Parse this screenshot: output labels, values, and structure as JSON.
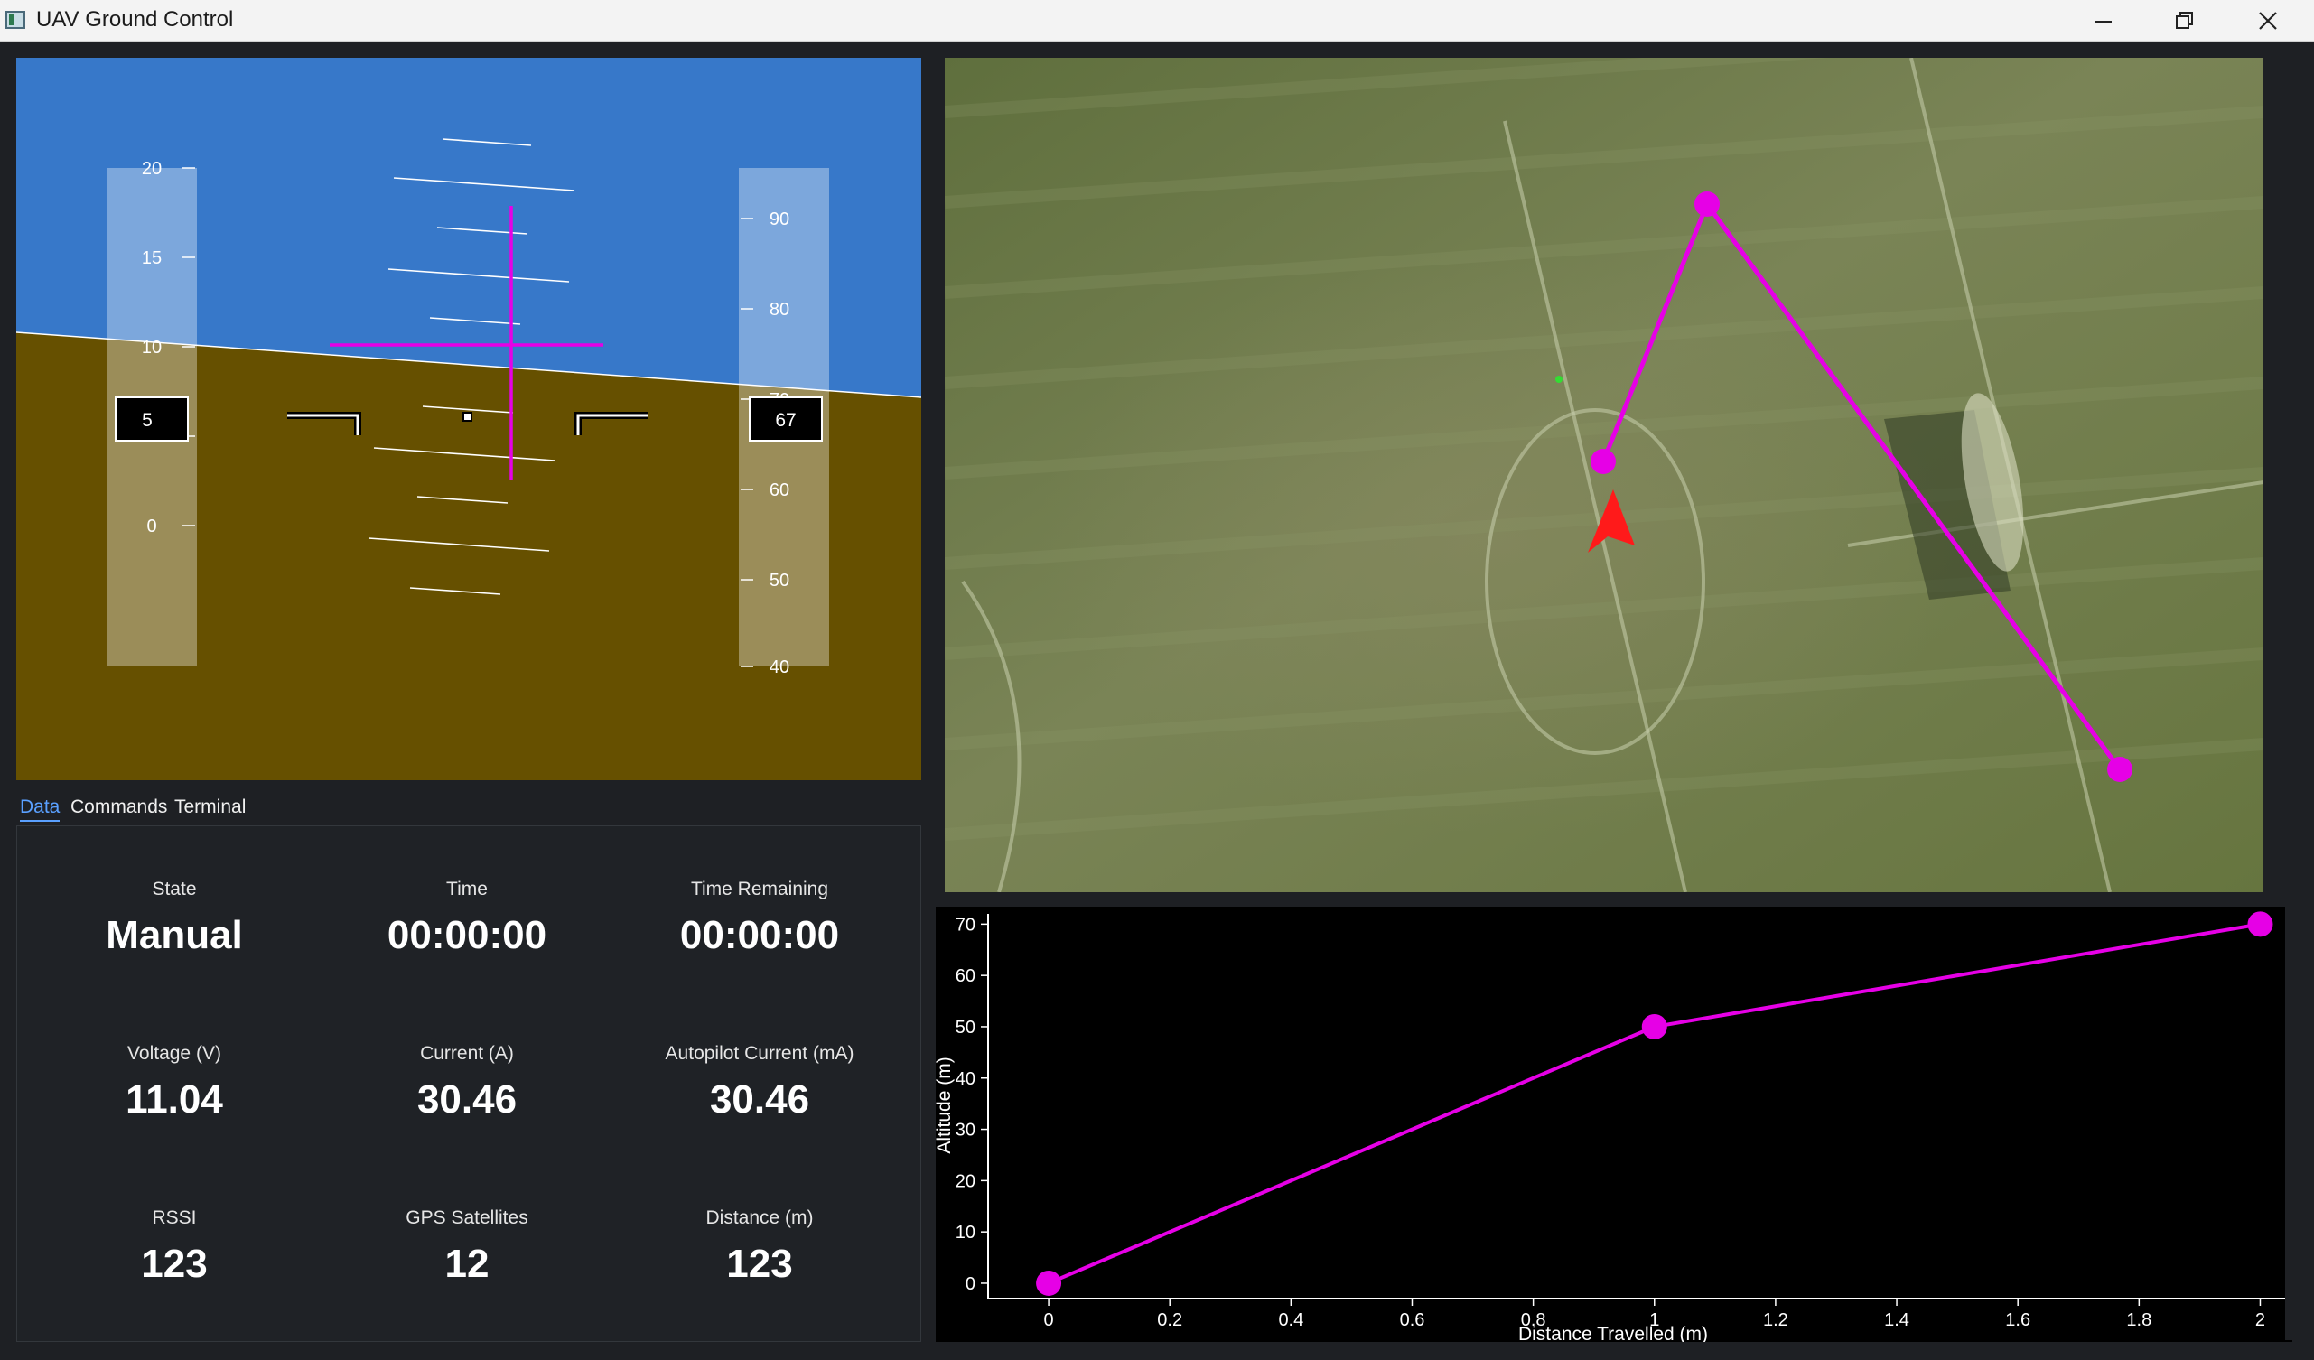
{
  "window": {
    "title": "UAV Ground Control",
    "minimize_icon": "minimize-icon",
    "maximize_icon": "restore-icon",
    "close_icon": "close-icon"
  },
  "attitude": {
    "sky_color": "#3778c9",
    "ground_color": "#665000",
    "accent_color": "#e600e6",
    "speed_tape": {
      "ticks": [
        "20",
        "15",
        "10",
        "5",
        "0"
      ],
      "current": "5"
    },
    "altitude_tape": {
      "ticks": [
        "90",
        "80",
        "70",
        "60",
        "50",
        "40"
      ],
      "current": "67"
    }
  },
  "tabs": [
    {
      "label": "Data",
      "active": true
    },
    {
      "label": "Commands",
      "active": false
    },
    {
      "label": "Terminal",
      "active": false
    }
  ],
  "data": {
    "state": {
      "label": "State",
      "value": "Manual"
    },
    "time": {
      "label": "Time",
      "value": "00:00:00"
    },
    "time_remaining": {
      "label": "Time Remaining",
      "value": "00:00:00"
    },
    "voltage": {
      "label": "Voltage (V)",
      "value": "11.04"
    },
    "current": {
      "label": "Current (A)",
      "value": "30.46"
    },
    "autopilot_current": {
      "label": "Autopilot Current (mA)",
      "value": "30.46"
    },
    "rssi": {
      "label": "RSSI",
      "value": "123"
    },
    "gps_satellites": {
      "label": "GPS Satellites",
      "value": "12"
    },
    "distance": {
      "label": "Distance (m)",
      "value": "123"
    }
  },
  "map": {
    "path_color": "#e600e6",
    "aircraft_color": "#ff1a1a",
    "waypoints": 4
  },
  "chart_data": {
    "type": "line",
    "x": [
      0,
      1,
      2
    ],
    "y": [
      0,
      50,
      70
    ],
    "xlabel": "Distance Travelled (m)",
    "ylabel": "Altitude (m)",
    "xlim": [
      -0.1,
      2.05
    ],
    "ylim": [
      -3,
      72
    ],
    "xticks": [
      "0",
      "0.2",
      "0.4",
      "0.6",
      "0.8",
      "1",
      "1.2",
      "1.4",
      "1.6",
      "1.8",
      "2"
    ],
    "yticks": [
      "0",
      "10",
      "20",
      "30",
      "40",
      "50",
      "60",
      "70"
    ],
    "grid": false,
    "color": "#e600e6"
  }
}
